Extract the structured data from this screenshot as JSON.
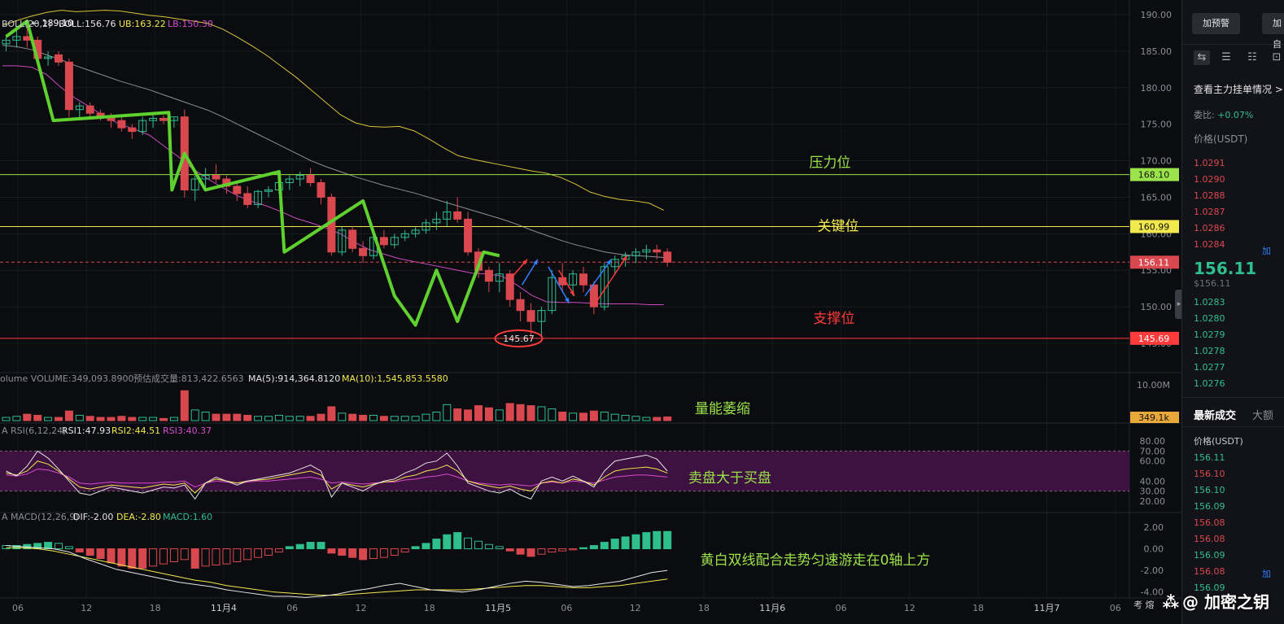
{
  "chart_data": {
    "type": "candlestick",
    "price_axis": {
      "ticks": [
        "190.00",
        "185.00",
        "180.00",
        "175.00",
        "170.00",
        "165.00",
        "160.00",
        "155.00",
        "150.00",
        "145.00"
      ],
      "ylim": [
        143,
        192
      ]
    },
    "time_axis": [
      "06",
      "12",
      "18",
      "11月4",
      "06",
      "12",
      "18",
      "11月5",
      "06",
      "12",
      "18",
      "11月6",
      "06",
      "12",
      "18",
      "11月7",
      "06"
    ],
    "boll": {
      "label": "BOLL(20,2)",
      "boll": "BOLL:156.76",
      "ub": "UB:163.22",
      "lb": "LB:150.30"
    },
    "high_marker": "← 189.10",
    "low_marker": "145.67",
    "levels": [
      {
        "name": "压力位",
        "price": 168.1,
        "label": "168.10",
        "color": "#9be34a"
      },
      {
        "name": "关键位",
        "price": 160.99,
        "label": "160.99",
        "color": "#f2e94e"
      },
      {
        "name": "支撑位",
        "price": 145.69,
        "label": "145.69",
        "color": "#ff3b3b"
      }
    ],
    "current_price": {
      "price": 156.11,
      "label": "156.11"
    },
    "candles": [
      [
        186,
        187,
        185,
        186.5
      ],
      [
        186.5,
        188,
        185.5,
        187
      ],
      [
        187,
        189.1,
        185.5,
        186.5
      ],
      [
        186.5,
        187,
        183.5,
        184
      ],
      [
        184,
        185,
        183,
        184.2
      ],
      [
        184.5,
        185,
        183,
        183.5
      ],
      [
        183.5,
        184,
        176,
        177
      ],
      [
        177,
        178,
        175.5,
        177.5
      ],
      [
        177.5,
        178,
        176,
        176.5
      ],
      [
        176.5,
        177,
        175.5,
        176
      ],
      [
        176,
        176.5,
        174.5,
        175.5
      ],
      [
        175.5,
        176,
        174,
        174.5
      ],
      [
        174.5,
        175,
        173,
        174
      ],
      [
        174,
        176,
        173.5,
        175.5
      ],
      [
        175.5,
        176.5,
        174.5,
        175.8
      ],
      [
        175.8,
        176.2,
        175,
        175.5
      ],
      [
        175.5,
        176,
        174.5,
        176
      ],
      [
        176,
        177,
        165,
        166
      ],
      [
        166,
        168,
        164.5,
        167.5
      ],
      [
        167.5,
        169,
        166,
        168
      ],
      [
        168,
        169.5,
        167,
        167.5
      ],
      [
        167.5,
        168,
        165.5,
        166.5
      ],
      [
        166.5,
        167,
        164.5,
        165.5
      ],
      [
        165.5,
        166.5,
        163.5,
        164
      ],
      [
        164,
        166,
        163.5,
        165.8
      ],
      [
        165.8,
        166.5,
        165,
        166
      ],
      [
        166,
        167.5,
        165.5,
        167
      ],
      [
        167,
        168,
        166,
        167.5
      ],
      [
        167.5,
        168.5,
        166.5,
        168
      ],
      [
        168,
        169,
        166.5,
        167
      ],
      [
        167,
        167.5,
        164,
        165
      ],
      [
        165,
        165.5,
        157,
        157.5
      ],
      [
        157.5,
        161,
        157,
        160.5
      ],
      [
        160.5,
        161,
        157.5,
        158
      ],
      [
        158,
        159,
        156,
        157
      ],
      [
        157,
        160,
        156.5,
        159.5
      ],
      [
        159.5,
        160.5,
        158,
        158.5
      ],
      [
        158.5,
        160,
        158,
        159.5
      ],
      [
        159.5,
        160.5,
        159,
        160
      ],
      [
        160,
        161,
        159.5,
        160.5
      ],
      [
        160.5,
        162,
        160,
        161.5
      ],
      [
        161.5,
        163,
        160.5,
        162
      ],
      [
        162,
        164.5,
        161,
        163
      ],
      [
        163,
        165,
        161.5,
        162
      ],
      [
        162,
        163,
        157,
        157.5
      ],
      [
        157.5,
        158,
        154,
        155
      ],
      [
        155,
        155.5,
        152,
        153.5
      ],
      [
        153.5,
        156,
        152,
        154.5
      ],
      [
        154.5,
        155,
        150,
        151
      ],
      [
        151,
        152,
        148,
        149.5
      ],
      [
        149.5,
        150.5,
        145.67,
        148
      ],
      [
        148,
        150,
        146,
        149.5
      ],
      [
        149.5,
        155,
        149,
        154
      ],
      [
        154,
        156,
        152,
        153
      ],
      [
        153,
        155,
        151.5,
        154.5
      ],
      [
        154.5,
        155.5,
        152,
        153
      ],
      [
        153,
        153.5,
        149,
        150
      ],
      [
        150,
        156,
        149.5,
        155.5
      ],
      [
        155.5,
        157,
        154.5,
        156.5
      ],
      [
        156.5,
        157.5,
        155.5,
        157
      ],
      [
        157,
        158,
        156,
        157.5
      ],
      [
        157.5,
        158.5,
        156.5,
        157.8
      ],
      [
        157.8,
        158.5,
        156.5,
        157.5
      ],
      [
        157.5,
        158,
        155.5,
        156.11
      ]
    ],
    "boll_lines": {
      "ub": [
        188.5,
        189.2,
        189.8,
        190.3,
        190.6,
        190.4,
        190.5,
        190.6,
        190.5,
        190.2,
        189.9,
        189.7,
        189.4,
        189.1,
        188.8,
        188.0,
        186.9,
        185.7,
        184.4,
        182.9,
        181.4,
        179.7,
        178.0,
        176.3,
        175.2,
        174.7,
        174.6,
        174.7,
        174.1,
        173.0,
        171.8,
        170.7,
        170.2,
        169.8,
        169.4,
        169.0,
        168.6,
        168.3,
        167.7,
        166.8,
        165.7,
        165.1,
        164.7,
        164.5,
        164.2,
        163.22
      ],
      "mid": [
        185.8,
        185.6,
        185.2,
        184.5,
        183.8,
        183.0,
        182.3,
        181.6,
        180.9,
        180.3,
        179.7,
        179.0,
        178.3,
        177.6,
        176.9,
        176.0,
        175.0,
        174.0,
        173.0,
        172.0,
        171.0,
        170.0,
        169.2,
        168.5,
        167.8,
        167.2,
        166.6,
        166.1,
        165.6,
        165.0,
        164.4,
        163.8,
        163.2,
        162.6,
        162.0,
        161.3,
        160.5,
        159.8,
        159.1,
        158.5,
        158.0,
        157.5,
        157.2,
        157.0,
        156.9,
        156.76
      ],
      "lb": [
        183.0,
        183.0,
        182.8,
        181.8,
        180.0,
        178.5,
        177.3,
        176.0,
        175.0,
        174.3,
        173.5,
        172.0,
        170.5,
        168.8,
        167.5,
        166.3,
        165.2,
        164.4,
        163.8,
        163.0,
        162.1,
        161.5,
        160.8,
        160.0,
        158.8,
        157.8,
        157.2,
        156.6,
        156.2,
        155.8,
        155.4,
        155.0,
        154.6,
        154.5,
        154.2,
        153.0,
        151.6,
        150.7,
        150.6,
        150.6,
        150.5,
        150.4,
        150.4,
        150.4,
        150.3,
        150.3
      ]
    },
    "pattern_line": [
      [
        0,
        187
      ],
      [
        2,
        189.1
      ],
      [
        4.5,
        175.5
      ],
      [
        15.5,
        176.6
      ],
      [
        15.8,
        166
      ],
      [
        17,
        171
      ],
      [
        19,
        166
      ],
      [
        26,
        168.5
      ],
      [
        26.5,
        157.5
      ],
      [
        34,
        164.5
      ],
      [
        37,
        151.5
      ],
      [
        39,
        147.5
      ],
      [
        41,
        155
      ],
      [
        43,
        148
      ],
      [
        45.5,
        157.5
      ],
      [
        47,
        157
      ]
    ],
    "projection_arrows": [
      {
        "color": "#ff3b3b",
        "from": [
          48.5,
          154
        ],
        "to": [
          50,
          156.5
        ]
      },
      {
        "color": "#2f80ff",
        "from": [
          49.5,
          153
        ],
        "to": [
          51,
          156.5
        ]
      },
      {
        "color": "#2f80ff",
        "from": [
          52,
          155.5
        ],
        "to": [
          54,
          150.5
        ]
      },
      {
        "color": "#ff3b3b",
        "from": [
          53,
          155
        ],
        "to": [
          54.5,
          151.5
        ]
      },
      {
        "color": "#2f80ff",
        "from": [
          55.5,
          151.5
        ],
        "to": [
          58,
          156.5
        ]
      },
      {
        "color": "#ff3b3b",
        "from": [
          56.5,
          150.5
        ],
        "to": [
          59.5,
          157
        ]
      }
    ],
    "volume": {
      "label": "olume VOLUME:349,093.8900",
      "est": "预估成交量:813,422.6563",
      "ma5": "MA(5):914,364.8120",
      "ma10": "MA(10):1,545,853.5580",
      "axis_max": "10.00M",
      "current": "349.1k",
      "values": [
        0.3,
        0.4,
        0.6,
        0.5,
        0.3,
        0.3,
        0.9,
        0.5,
        0.4,
        0.3,
        0.3,
        0.4,
        0.3,
        0.3,
        0.3,
        0.2,
        0.3,
        2.8,
        1.0,
        0.8,
        0.6,
        0.6,
        0.6,
        0.5,
        0.4,
        0.4,
        0.5,
        0.4,
        0.4,
        0.4,
        0.6,
        1.3,
        0.7,
        0.6,
        0.5,
        0.5,
        0.4,
        0.4,
        0.4,
        0.4,
        0.6,
        0.8,
        1.5,
        1.1,
        1.0,
        1.4,
        1.2,
        1.0,
        1.6,
        1.5,
        1.4,
        1.3,
        1.1,
        0.8,
        0.7,
        0.7,
        0.9,
        0.8,
        0.6,
        0.5,
        0.4,
        0.3,
        0.3,
        0.35
      ]
    },
    "rsi": {
      "label": "A RSI(6,12,24)",
      "rsi1": "RSI1:47.93",
      "rsi2": "RSI2:44.51",
      "rsi3": "RSI3:40.37",
      "ticks": [
        "80.00",
        "70.00",
        "60.00",
        "40.00",
        "30.00",
        "20.00"
      ],
      "rsi1_values": [
        50,
        45,
        55,
        70,
        63,
        52,
        40,
        28,
        26,
        30,
        34,
        32,
        30,
        28,
        31,
        34,
        33,
        36,
        22,
        38,
        44,
        40,
        36,
        40,
        42,
        44,
        46,
        48,
        52,
        56,
        50,
        24,
        38,
        34,
        30,
        36,
        40,
        42,
        48,
        52,
        58,
        60,
        68,
        55,
        38,
        34,
        30,
        28,
        32,
        26,
        22,
        40,
        44,
        40,
        45,
        40,
        34,
        50,
        60,
        62,
        64,
        66,
        62,
        50
      ],
      "rsi2_values": [
        48,
        46,
        50,
        60,
        57,
        50,
        42,
        34,
        32,
        34,
        36,
        35,
        34,
        33,
        35,
        37,
        36,
        38,
        28,
        38,
        42,
        40,
        38,
        40,
        41,
        42,
        44,
        46,
        48,
        50,
        46,
        32,
        38,
        36,
        34,
        37,
        39,
        40,
        44,
        46,
        50,
        52,
        56,
        50,
        40,
        37,
        35,
        33,
        35,
        32,
        30,
        38,
        40,
        38,
        42,
        40,
        36,
        44,
        50,
        52,
        53,
        54,
        52,
        48
      ],
      "rsi3_values": [
        46,
        45,
        47,
        52,
        51,
        48,
        44,
        38,
        37,
        38,
        39,
        38,
        38,
        38,
        38,
        39,
        39,
        40,
        34,
        38,
        40,
        39,
        38,
        39,
        40,
        40,
        41,
        42,
        43,
        44,
        42,
        38,
        39,
        38,
        37,
        38,
        39,
        39,
        41,
        42,
        44,
        45,
        47,
        44,
        40,
        38,
        37,
        36,
        37,
        36,
        35,
        38,
        39,
        38,
        40,
        39,
        38,
        41,
        44,
        45,
        46,
        46,
        45,
        44
      ]
    },
    "macd": {
      "label": "A MACD(12,26,9)",
      "dif": "DIF:-2.00",
      "dea": "DEA:-2.80",
      "macd": "MACD:1.60",
      "ticks": [
        "2.00",
        "0.00",
        "-2.00",
        "-4.00"
      ],
      "hist": [
        0.3,
        0.3,
        0.4,
        0.5,
        0.6,
        0.5,
        0.2,
        -0.3,
        -0.6,
        -0.9,
        -1.3,
        -1.6,
        -1.8,
        -1.8,
        -1.6,
        -1.4,
        -1.2,
        -1.0,
        -1.8,
        -1.6,
        -1.5,
        -1.4,
        -1.2,
        -1.0,
        -0.8,
        -0.6,
        -0.3,
        0.2,
        0.4,
        0.6,
        0.6,
        -0.4,
        -0.6,
        -0.8,
        -1.0,
        -0.9,
        -0.8,
        -0.6,
        -0.3,
        0.2,
        0.5,
        0.9,
        1.3,
        1.5,
        1.0,
        0.7,
        0.4,
        0.2,
        -0.2,
        -0.5,
        -0.7,
        -0.5,
        -0.3,
        -0.2,
        -0.1,
        0.1,
        0.3,
        0.6,
        0.9,
        1.1,
        1.3,
        1.5,
        1.6,
        1.6
      ],
      "dif_values": [
        0.3,
        0.2,
        0.1,
        0.0,
        -0.3,
        -0.9,
        -1.4,
        -1.9,
        -2.2,
        -2.5,
        -2.8,
        -3.1,
        -3.3,
        -3.5,
        -3.8,
        -4.0,
        -4.2,
        -4.4,
        -4.4,
        -4.5,
        -4.4,
        -4.2,
        -3.9,
        -3.7,
        -3.4,
        -3.2,
        -3.5,
        -3.8,
        -3.9,
        -4.0,
        -3.8,
        -3.5,
        -3.2,
        -3.0,
        -3.1,
        -3.3,
        -3.5,
        -3.4,
        -3.2,
        -3.0,
        -2.6,
        -2.2,
        -2.0
      ],
      "dea_values": [
        0.1,
        0.1,
        0.0,
        -0.2,
        -0.5,
        -0.8,
        -1.1,
        -1.4,
        -1.7,
        -2.0,
        -2.3,
        -2.6,
        -2.9,
        -3.1,
        -3.4,
        -3.6,
        -3.8,
        -4.0,
        -4.1,
        -4.2,
        -4.3,
        -4.3,
        -4.2,
        -4.1,
        -4.0,
        -3.9,
        -3.8,
        -3.8,
        -3.8,
        -3.8,
        -3.7,
        -3.6,
        -3.5,
        -3.4,
        -3.4,
        -3.5,
        -3.6,
        -3.6,
        -3.5,
        -3.4,
        -3.2,
        -3.0,
        -2.8
      ]
    },
    "annotations": {
      "volume_note": "量能萎缩",
      "rsi_note": "卖盘大于买盘",
      "macd_note": "黄白双线配合走势匀速游走在0轴上方"
    }
  },
  "sidebar": {
    "alert_button": "加预警",
    "add_button": "加自",
    "orderbook_title": "查看主力挂单情况 >",
    "ratio_label": "委比:",
    "ratio_value": "+0.07%",
    "price_label": "价格(USDT)",
    "asks": [
      "1.0291",
      "1.0290",
      "1.0288",
      "1.0287",
      "1.0286",
      "1.0284"
    ],
    "big_price": "156.11",
    "sub_price": "$156.11",
    "bids": [
      "1.0283",
      "1.0280",
      "1.0279",
      "1.0278",
      "1.0277",
      "1.0276"
    ],
    "side_tag": "加",
    "tab_latest": "最新成交",
    "tab_big": "大额",
    "trades_price_label": "价格(USDT)",
    "trades": [
      "156.11",
      "156.10",
      "156.10",
      "156.09",
      "156.08",
      "156.08",
      "156.09",
      "156.08",
      "156.09"
    ],
    "trades_side": "加"
  },
  "watermark": "@ 加密之钥",
  "watermark_left": "考 熔"
}
